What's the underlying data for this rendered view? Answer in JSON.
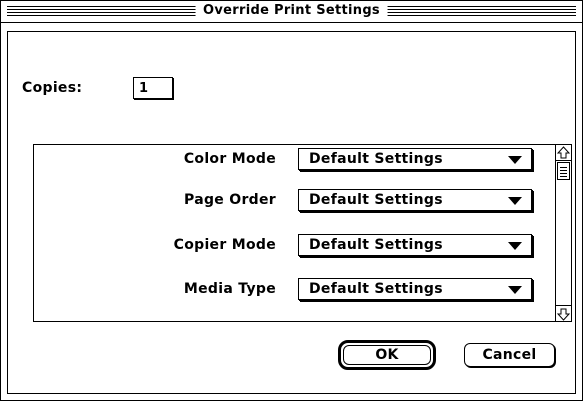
{
  "dialog": {
    "title": "Override Print Settings"
  },
  "copies": {
    "label": "Copies:",
    "value": "1"
  },
  "settings": [
    {
      "label": "Color Mode",
      "value": "Default Settings"
    },
    {
      "label": "Page Order",
      "value": "Default Settings"
    },
    {
      "label": "Copier Mode",
      "value": "Default Settings"
    },
    {
      "label": "Media Type",
      "value": "Default Settings"
    }
  ],
  "buttons": {
    "ok": "OK",
    "cancel": "Cancel"
  },
  "icons": {
    "popup_arrow": "triangle-down-icon",
    "scroll_up": "scroll-up-arrow-icon",
    "scroll_down": "scroll-down-arrow-icon"
  }
}
